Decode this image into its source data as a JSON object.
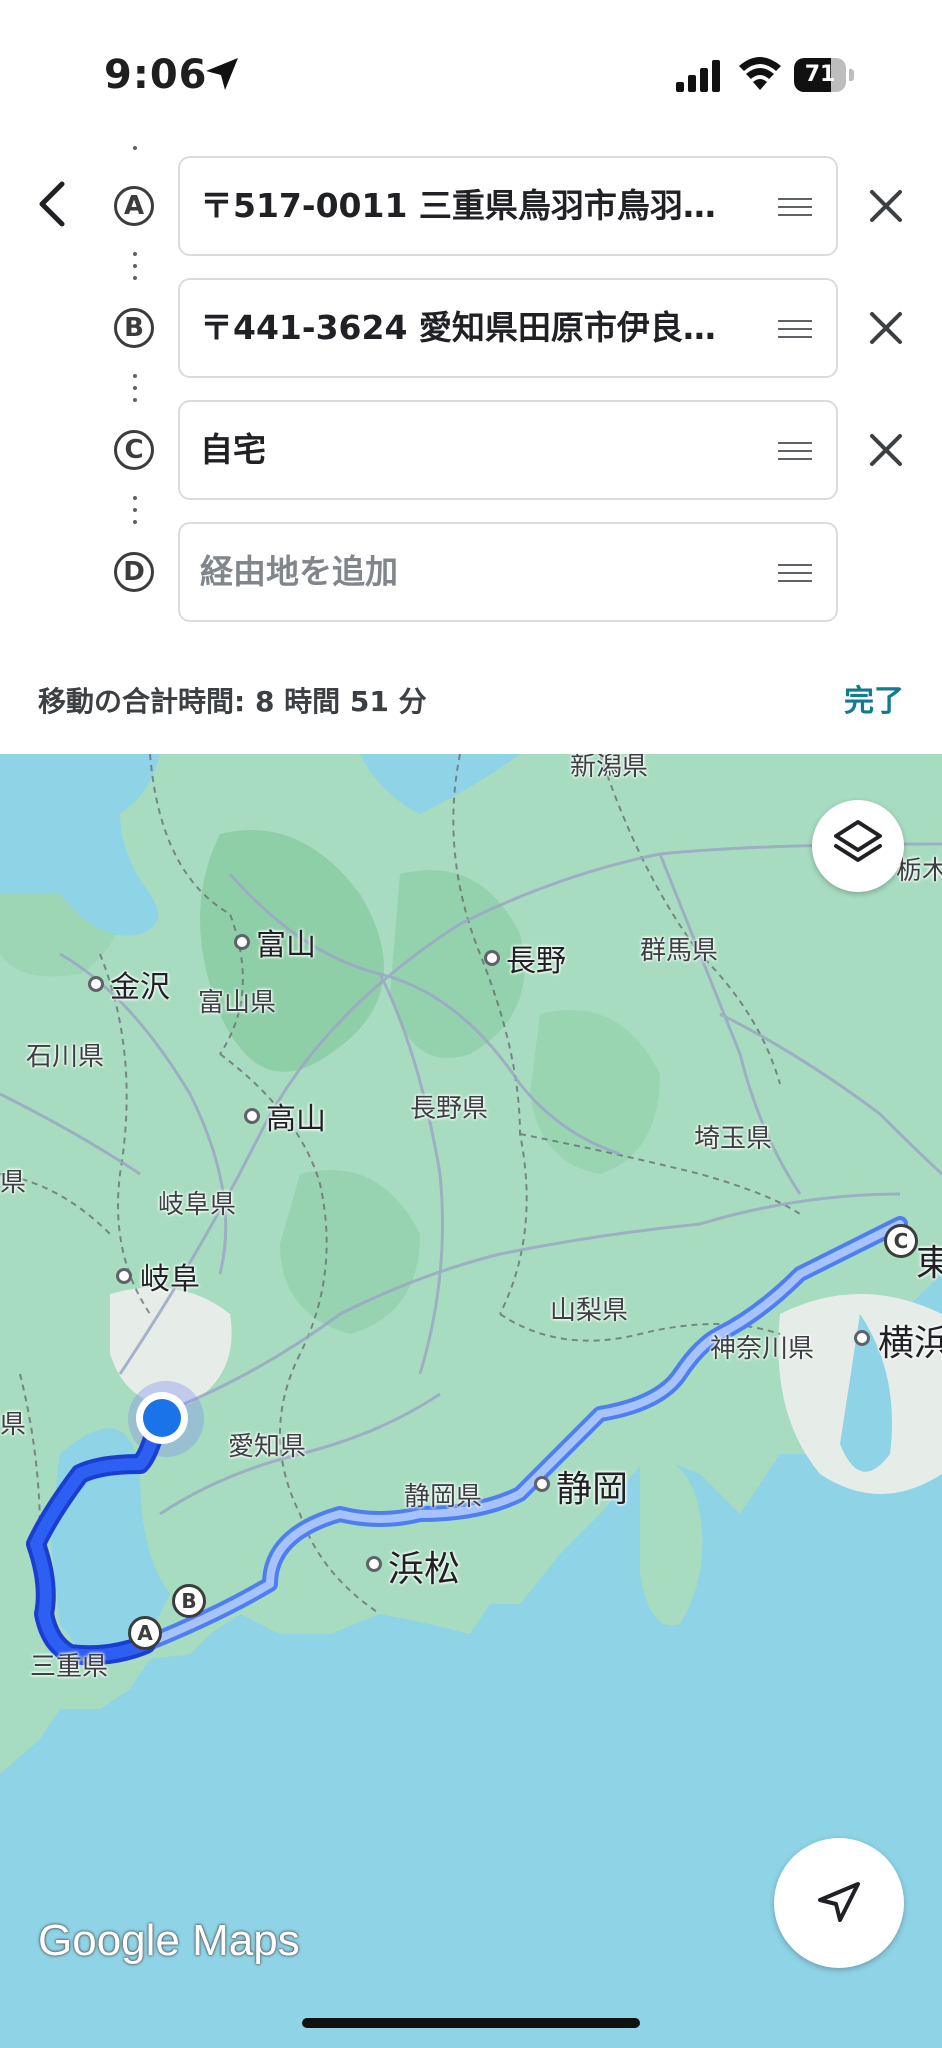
{
  "status": {
    "time": "9:06",
    "battery": "71",
    "battery_level": 0.71
  },
  "stops": [
    {
      "marker": "A",
      "text": "〒517-0011 三重県鳥羽市鳥羽３…"
    },
    {
      "marker": "B",
      "text": "〒441-3624 愛知県田原市伊良…"
    },
    {
      "marker": "C",
      "text": "自宅"
    },
    {
      "marker": "D",
      "placeholder": "経由地を追加"
    }
  ],
  "summary": {
    "total_time": "移動の合計時間: 8 時間 51 分"
  },
  "done_label": "完了",
  "map": {
    "labels": {
      "niigata": "新潟県",
      "toyama": "富山",
      "kanazawa": "金沢",
      "toyama_pref": "富山県",
      "ishikawa_pref": "石川県",
      "nagano": "長野",
      "gunma_pref": "群馬県",
      "tochigi_pref": "栃木県",
      "takayama": "高山",
      "nagano_pref": "長野県",
      "saitama_pref": "埼玉県",
      "fukui_pref": "県",
      "gifu_pref": "岐阜県",
      "gifu": "岐阜",
      "yamanashi_pref": "山梨県",
      "kanagawa_pref": "神奈川県",
      "tokyo": "東",
      "yokohama": "横浜",
      "aichi_pref": "愛知県",
      "shizuoka_pref": "静岡県",
      "shizuoka": "静岡",
      "hamamatsu": "浜松",
      "mie_pref": "三重県",
      "shiga_pref": "県"
    },
    "route_markers": {
      "a": "A",
      "b": "B",
      "c": "C"
    },
    "logo": "Google Maps",
    "colors": {
      "water": "#8ed3e6",
      "land": "#a8dcc0",
      "route_primary": "#1a4fe0",
      "route_alt": "#8ab4f8"
    }
  }
}
